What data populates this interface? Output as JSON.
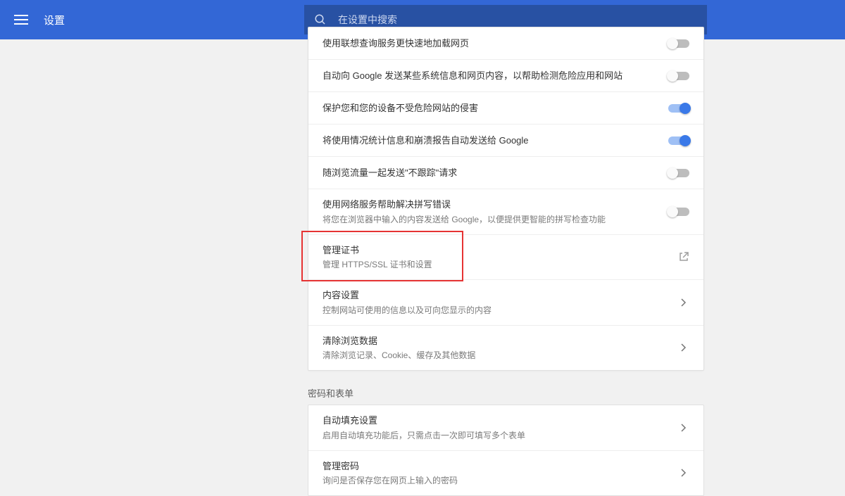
{
  "header": {
    "title": "设置",
    "search_placeholder": "在设置中搜索"
  },
  "settings_rows": [
    {
      "title": "使用联想查询服务更快速地加载网页",
      "sub": "",
      "control": "toggle",
      "on": false
    },
    {
      "title": "自动向 Google 发送某些系统信息和网页内容，以帮助检测危险应用和网站",
      "sub": "",
      "control": "toggle",
      "on": false
    },
    {
      "title": "保护您和您的设备不受危险网站的侵害",
      "sub": "",
      "control": "toggle",
      "on": true
    },
    {
      "title": "将使用情况统计信息和崩溃报告自动发送给 Google",
      "sub": "",
      "control": "toggle",
      "on": true
    },
    {
      "title": "随浏览流量一起发送\"不跟踪\"请求",
      "sub": "",
      "control": "toggle",
      "on": false
    },
    {
      "title": "使用网络服务帮助解决拼写错误",
      "sub": "将您在浏览器中输入的内容发送给 Google，以便提供更智能的拼写检查功能",
      "control": "toggle",
      "on": false
    },
    {
      "title": "管理证书",
      "sub": "管理 HTTPS/SSL 证书和设置",
      "control": "external"
    },
    {
      "title": "内容设置",
      "sub": "控制网站可使用的信息以及可向您显示的内容",
      "control": "chevron"
    },
    {
      "title": "清除浏览数据",
      "sub": "清除浏览记录、Cookie、缓存及其他数据",
      "control": "chevron"
    }
  ],
  "section2_label": "密码和表单",
  "section2_rows": [
    {
      "title": "自动填充设置",
      "sub": "启用自动填充功能后，只需点击一次即可填写多个表单",
      "control": "chevron"
    },
    {
      "title": "管理密码",
      "sub": "询问是否保存您在网页上输入的密码",
      "control": "chevron"
    }
  ]
}
